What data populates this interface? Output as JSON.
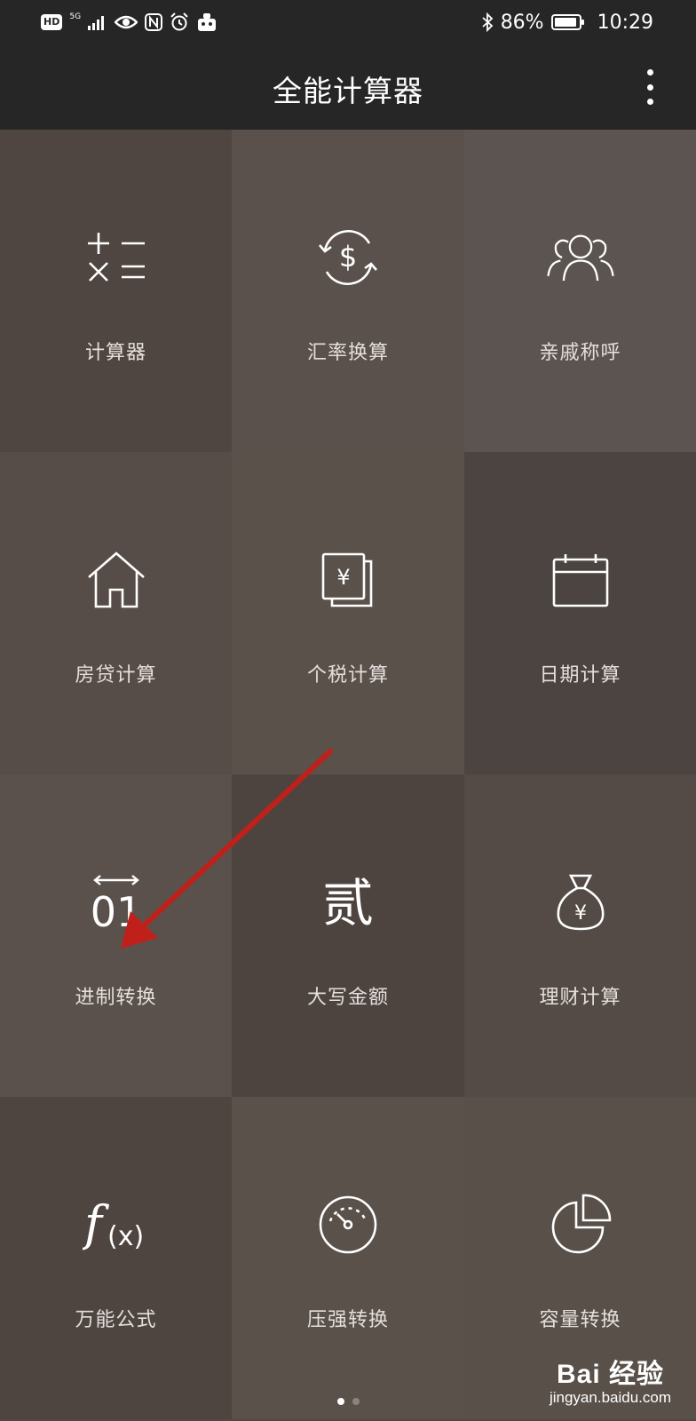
{
  "status_bar": {
    "hd": "HD",
    "network": "5G",
    "battery_percent": "86%",
    "time": "10:29",
    "icons": [
      "signal-icon",
      "eye-icon",
      "nfc-icon",
      "alarm-icon",
      "robot-icon",
      "bluetooth-icon",
      "battery-icon"
    ]
  },
  "app_bar": {
    "title": "全能计算器",
    "menu_icon": "more-vertical-icon"
  },
  "tiles": [
    {
      "label": "计算器",
      "icon": "calculator-icon",
      "color": "#4f4541"
    },
    {
      "label": "汇率换算",
      "icon": "currency-exchange-icon",
      "color": "#5a514c"
    },
    {
      "label": "亲戚称呼",
      "icon": "relatives-icon",
      "color": "#5c5450"
    },
    {
      "label": "房贷计算",
      "icon": "house-icon",
      "color": "#574d48"
    },
    {
      "label": "个税计算",
      "icon": "tax-icon",
      "color": "#5b514b"
    },
    {
      "label": "日期计算",
      "icon": "calendar-icon",
      "color": "#4c4440"
    },
    {
      "label": "进制转换",
      "icon": "base-conversion-icon",
      "color": "#5a514c"
    },
    {
      "label": "大写金额",
      "icon": "chinese-numeral-icon",
      "color": "#4d4440"
    },
    {
      "label": "理财计算",
      "icon": "money-bag-icon",
      "color": "#544b46"
    },
    {
      "label": "万能公式",
      "icon": "function-icon",
      "color": "#4e4541"
    },
    {
      "label": "压强转换",
      "icon": "pressure-gauge-icon",
      "color": "#5a514b"
    },
    {
      "label": "容量转换",
      "icon": "pie-chart-icon",
      "color": "#585049"
    }
  ],
  "tile_icon_text": {
    "base_top": "↔",
    "base_bottom": "01",
    "numeral": "贰",
    "yen": "¥",
    "dollar": "$",
    "function_f": "f",
    "function_x": "(x)"
  },
  "pager": {
    "active_color": "#ffffff",
    "inactive_color": "#8a8480",
    "count": 2,
    "active_index": 0
  },
  "watermark": {
    "logo": "Bai 经验",
    "url": "jingyan.baidu.com"
  },
  "annotation": {
    "arrow_color": "#c0201a"
  }
}
